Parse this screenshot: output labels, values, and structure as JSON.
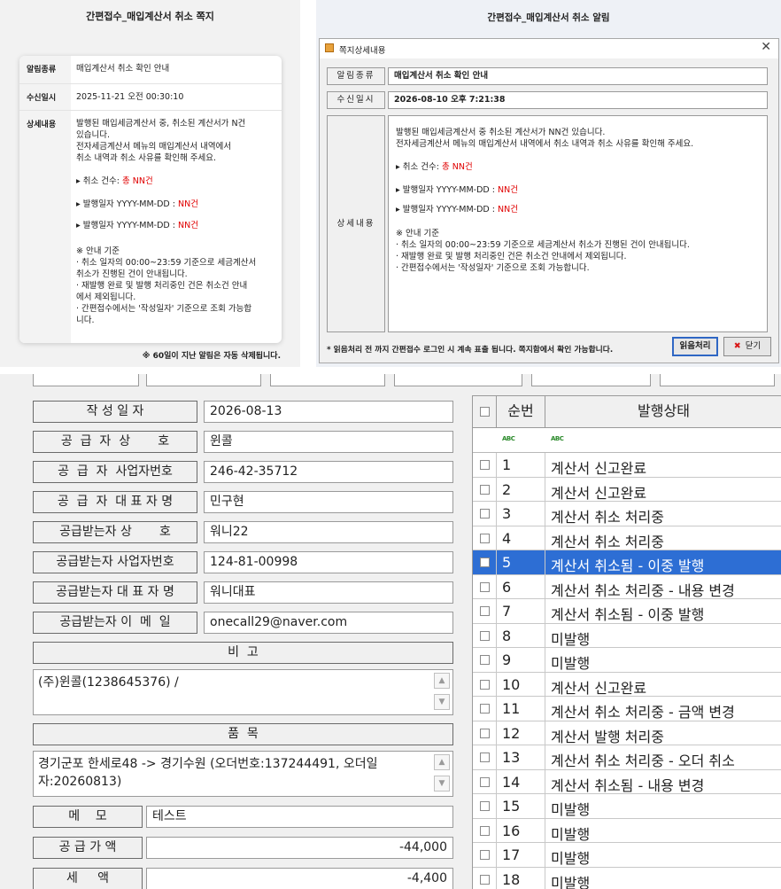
{
  "mobile_notice": {
    "title": "간편접수_매입계산서 취소 쪽지",
    "type_label": "알림종류",
    "type_value": "매입계산서 취소 확인 안내",
    "date_label": "수신일시",
    "date_value": "2025-11-21 오전 00:30:10",
    "detail_label": "상세내용",
    "detail_line1": "발행된 매입세금계산서 중, 취소된 계산서가 N건",
    "detail_line2": "있습니다.",
    "detail_line3": "전자세금계산서 메뉴의 매입계산서 내역에서",
    "detail_line4": "취소 내역과 취소 사유를 확인해 주세요.",
    "count_prefix": "▸ 취소 건수: ",
    "count_value": "총 NN건",
    "date1_prefix": "▸ 발행일자 YYYY-MM-DD : ",
    "date1_value": "NN건",
    "date2_prefix": "▸ 발행일자 YYYY-MM-DD : ",
    "date2_value": "NN건",
    "guide_head": "※ 안내 기준",
    "guide1a": "· 취소 일자의 00:00~23:59 기준으로 세금계산서",
    "guide1b": "취소가 진행된 건이 안내됩니다.",
    "guide2a": "· 재발행 완료 및 발행 처리중인 건은 취소건 안내",
    "guide2b": "에서 제외됩니다.",
    "guide3a": "· 간편접수에서는 '작성일자' 기준으로 조회 가능합",
    "guide3b": "니다.",
    "footer": "※ 60일이 지난 알림은 자동 삭제됩니다."
  },
  "desktop_notice": {
    "title": "간편접수_매입계산서 취소 알림",
    "window_title": "쪽지상세내용",
    "close_glyph": "✕",
    "type_label": "알림종류",
    "type_value": "매입계산서 취소 확인 안내",
    "date_label": "수신일시",
    "date_value": "2026-08-10 오후 7:21:38",
    "detail_label": "상세내용",
    "detail_line1": "발행된 매입세금계산서 중 취소된 계산서가 NN건 있습니다.",
    "detail_line2": "전자세금계산서 메뉴의 매입계산서 내역에서 취소 내역과 취소 사유를 확인해 주세요.",
    "count_prefix": "▸ 취소 건수: ",
    "count_value": "총 NN건",
    "date1_prefix": "▸ 발행일자 YYYY-MM-DD : ",
    "date1_value": "NN건",
    "date2_prefix": "▸ 발행일자 YYYY-MM-DD : ",
    "date2_value": "NN건",
    "guide_head": "※ 안내 기준",
    "guide1": "· 취소 일자의 00:00~23:59 기준으로 세금계산서 취소가 진행된 건이 안내됩니다.",
    "guide2": "· 재발행 완료 및 발행 처리중인 건은 취소건 안내에서 제외됩니다.",
    "guide3": "· 간편접수에서는 '작성일자' 기준으로 조회 가능합니다.",
    "footer_note": "* 읽음처리 전 까지 간편접수 로그인 시 계속 표출 됩니다. 쪽지함에서 확인 가능합니다.",
    "read_button": "읽음처리",
    "close_button": "닫기",
    "close_icon": "✖"
  },
  "form": {
    "fields": [
      {
        "label": "작 성 일 자",
        "value": "2026-08-13"
      },
      {
        "label": "공  급  자  상       호",
        "value": "윈콜"
      },
      {
        "label": "공  급  자  사업자번호",
        "value": "246-42-35712"
      },
      {
        "label": "공  급  자  대 표 자 명",
        "value": "민구현"
      },
      {
        "label": "공급받는자 상       호",
        "value": "워니22"
      },
      {
        "label": "공급받는자 사업자번호",
        "value": "124-81-00998"
      },
      {
        "label": "공급받는자 대 표 자 명",
        "value": "워니대표"
      },
      {
        "label": "공급받는자 이  메  일",
        "value": "onecall29@naver.com"
      }
    ],
    "remark_label": "비  고",
    "remark_value": "(주)윈콜(1238645376) /",
    "item_label": "품  목",
    "item_value": "경기군포 한세로48 -> 경기수원 (오더번호:137244491, 오더일자:20260813)",
    "memo_label": "메    모",
    "memo_value": "테스트",
    "supply_label": "공 급 가 액",
    "supply_value": "-44,000",
    "tax_label": "세     액",
    "tax_value": "-4,400",
    "scroll_up": "▲",
    "scroll_down": "▼"
  },
  "grid": {
    "col_no": "순번",
    "col_status": "발행상태",
    "filter_icon_text": "ABC",
    "rows": [
      {
        "no": "1",
        "status": "계산서 신고완료"
      },
      {
        "no": "2",
        "status": "계산서 신고완료"
      },
      {
        "no": "3",
        "status": "계산서 취소 처리중"
      },
      {
        "no": "4",
        "status": "계산서 취소 처리중"
      },
      {
        "no": "5",
        "status": "계산서 취소됨 - 이중 발행"
      },
      {
        "no": "6",
        "status": "계산서 취소 처리중 - 내용 변경"
      },
      {
        "no": "7",
        "status": "계산서 취소됨 - 이중 발행"
      },
      {
        "no": "8",
        "status": "미발행"
      },
      {
        "no": "9",
        "status": "미발행"
      },
      {
        "no": "10",
        "status": "계산서 신고완료"
      },
      {
        "no": "11",
        "status": "계산서 취소 처리중 - 금액 변경"
      },
      {
        "no": "12",
        "status": "계산서 발행 처리중"
      },
      {
        "no": "13",
        "status": "계산서 취소 처리중 - 오더 취소"
      },
      {
        "no": "14",
        "status": "계산서 취소됨 - 내용 변경"
      },
      {
        "no": "15",
        "status": "미발행"
      },
      {
        "no": "16",
        "status": "미발행"
      },
      {
        "no": "17",
        "status": "미발행"
      },
      {
        "no": "18",
        "status": "미발행"
      }
    ],
    "selected_row": 5,
    "selection_color": "#2d6ed4"
  }
}
